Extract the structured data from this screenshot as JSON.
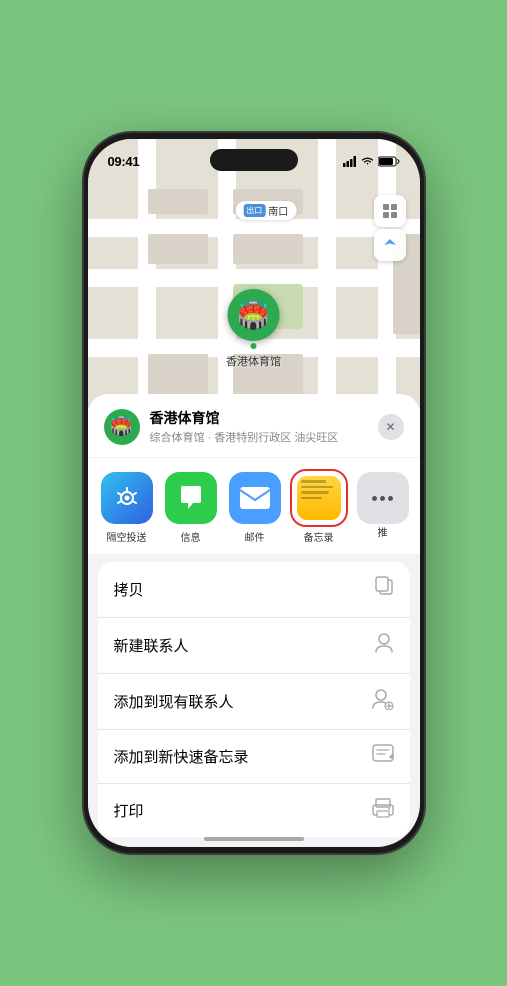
{
  "status_bar": {
    "time": "09:41",
    "location_arrow": true
  },
  "map": {
    "label_badge": "出口",
    "label_text": "南口",
    "venue_name": "香港体育馆",
    "venue_emoji": "🏟️"
  },
  "location_card": {
    "name": "香港体育馆",
    "description": "综合体育馆 · 香港特别行政区 油尖旺区",
    "close_label": "✕"
  },
  "app_icons": [
    {
      "id": "airdrop",
      "label": "隔空投送",
      "type": "airdrop"
    },
    {
      "id": "messages",
      "label": "信息",
      "type": "messages"
    },
    {
      "id": "mail",
      "label": "邮件",
      "type": "mail"
    },
    {
      "id": "notes",
      "label": "备忘录",
      "type": "notes"
    },
    {
      "id": "more",
      "label": "推",
      "type": "more"
    }
  ],
  "actions": [
    {
      "label": "拷贝",
      "icon": "📋"
    },
    {
      "label": "新建联系人",
      "icon": "👤"
    },
    {
      "label": "添加到现有联系人",
      "icon": "👤"
    },
    {
      "label": "添加到新快速备忘录",
      "icon": "📝"
    },
    {
      "label": "打印",
      "icon": "🖨️"
    }
  ]
}
